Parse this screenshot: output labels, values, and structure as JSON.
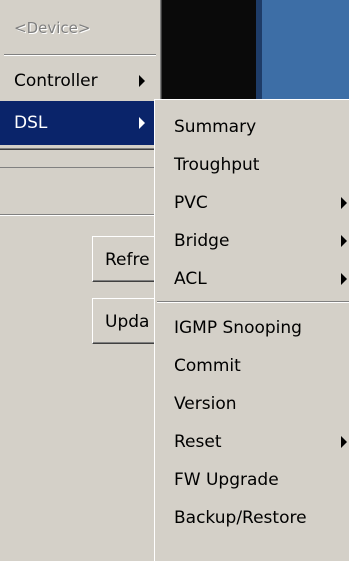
{
  "background": {
    "buttons": [
      {
        "label": "Refre"
      },
      {
        "label": "Upda"
      }
    ]
  },
  "menu": {
    "items": [
      {
        "label": "<Device>",
        "disabled": true
      },
      {
        "label": "Controller",
        "has_submenu": true
      },
      {
        "label": "DSL",
        "has_submenu": true,
        "selected": true
      }
    ]
  },
  "submenu": {
    "items": [
      {
        "label": "Summary"
      },
      {
        "label": "Troughput"
      },
      {
        "label": "PVC",
        "has_submenu": true
      },
      {
        "label": "Bridge",
        "has_submenu": true
      },
      {
        "label": "ACL",
        "has_submenu": true
      },
      {
        "label": "IGMP Snooping"
      },
      {
        "label": "Commit"
      },
      {
        "label": "Version"
      },
      {
        "label": "Reset",
        "has_submenu": true
      },
      {
        "label": "FW Upgrade"
      },
      {
        "label": "Backup/Restore"
      }
    ]
  },
  "colors": {
    "menu_bg": "#d4d0c8",
    "selection": "#0a246a",
    "background_app_dark": "#0a0a0a",
    "background_app_blue": "#3d6ea6"
  }
}
